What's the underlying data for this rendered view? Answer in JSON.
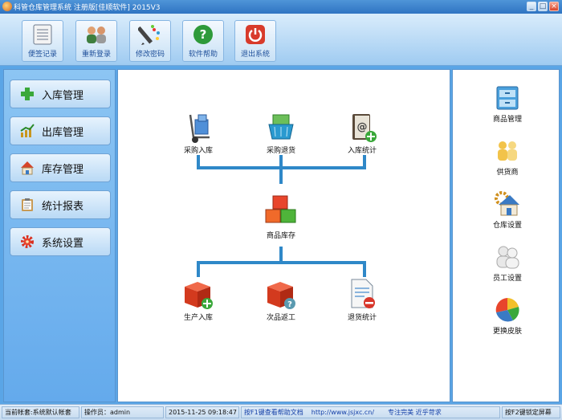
{
  "window": {
    "title": "科管仓库管理系统 注册版[佳顺软件] 2015V3",
    "min": "_",
    "max": "□",
    "close": "×"
  },
  "toolbar": [
    {
      "label": "便签记录",
      "icon": "notepad-icon"
    },
    {
      "label": "重新登录",
      "icon": "users-icon"
    },
    {
      "label": "修改密码",
      "icon": "pencil-icon"
    },
    {
      "label": "软件帮助",
      "icon": "help-icon"
    },
    {
      "label": "退出系统",
      "icon": "power-icon"
    }
  ],
  "nav": [
    {
      "label": "入库管理",
      "icon": "plus-icon"
    },
    {
      "label": "出库管理",
      "icon": "chart-up-icon"
    },
    {
      "label": "库存管理",
      "icon": "house-icon"
    },
    {
      "label": "统计报表",
      "icon": "clipboard-icon"
    },
    {
      "label": "系统设置",
      "icon": "gear-icon"
    }
  ],
  "flow": {
    "top": [
      "采购入库",
      "采购退货",
      "入库统计"
    ],
    "middle": "商品库存",
    "bottom": [
      "生产入库",
      "次品返工",
      "退货统计"
    ]
  },
  "side": [
    "商品管理",
    "供货商",
    "仓库设置",
    "员工设置",
    "更换皮肤"
  ],
  "status": {
    "account": "当前帐套:系统默认帐套",
    "operator": "操作员：admin",
    "datetime": "2015-11-25 09:18:47",
    "help": "按F1键查看帮助文档",
    "url": "http://www.jsjxc.cn/",
    "slogan": "专注完美 近乎苛求",
    "lock": "按F2键锁定屏幕"
  },
  "colors": {
    "accent": "#2f88c8",
    "link": "#1540a8"
  }
}
